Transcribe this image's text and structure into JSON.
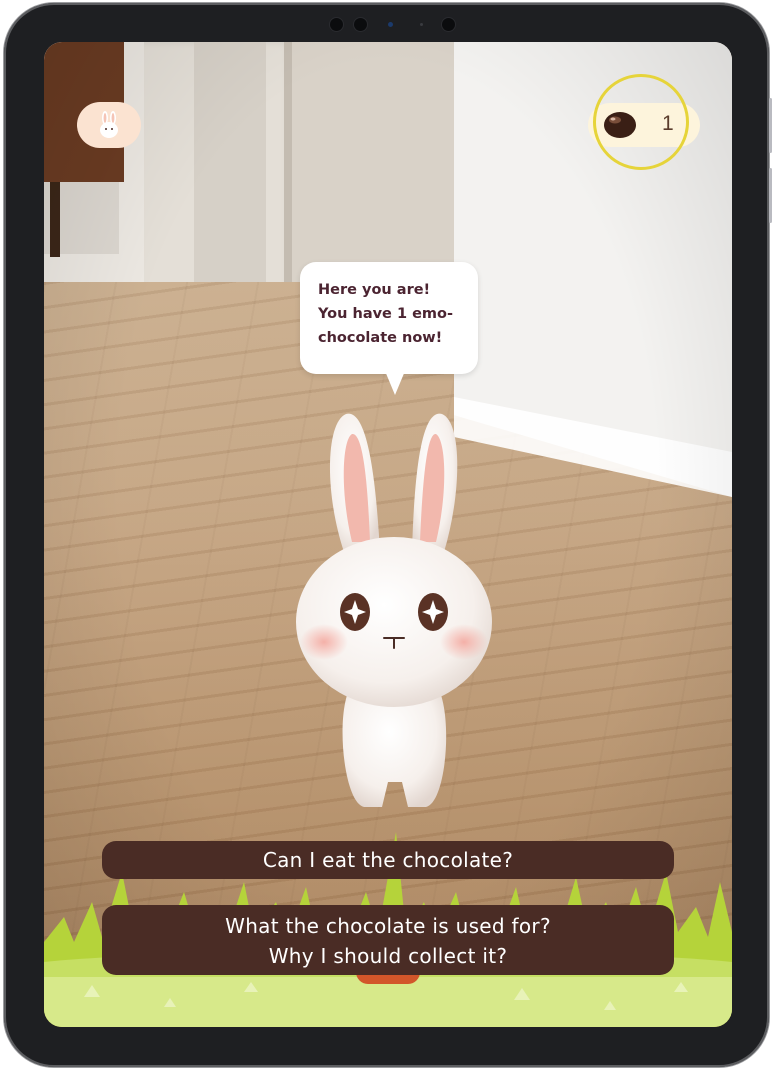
{
  "app": {
    "speech": "Here you are!\nYou have 1 emo-\nchocolate now!",
    "chocolate_count": "1",
    "choices": [
      {
        "label_lines": [
          "Can I eat the chocolate?"
        ]
      },
      {
        "label_lines": [
          "What the chocolate is used for?",
          "Why I should collect it?"
        ]
      }
    ]
  },
  "icons": {
    "profile": "bunny-head-icon",
    "currency": "chocolate-icon"
  },
  "colors": {
    "choice_button": "#4a2c25",
    "counter_bg": "#fdf4dc",
    "profile_bg": "#fbe3d1",
    "highlight_ring": "#e6d43a",
    "grass": "#b5d33a"
  }
}
